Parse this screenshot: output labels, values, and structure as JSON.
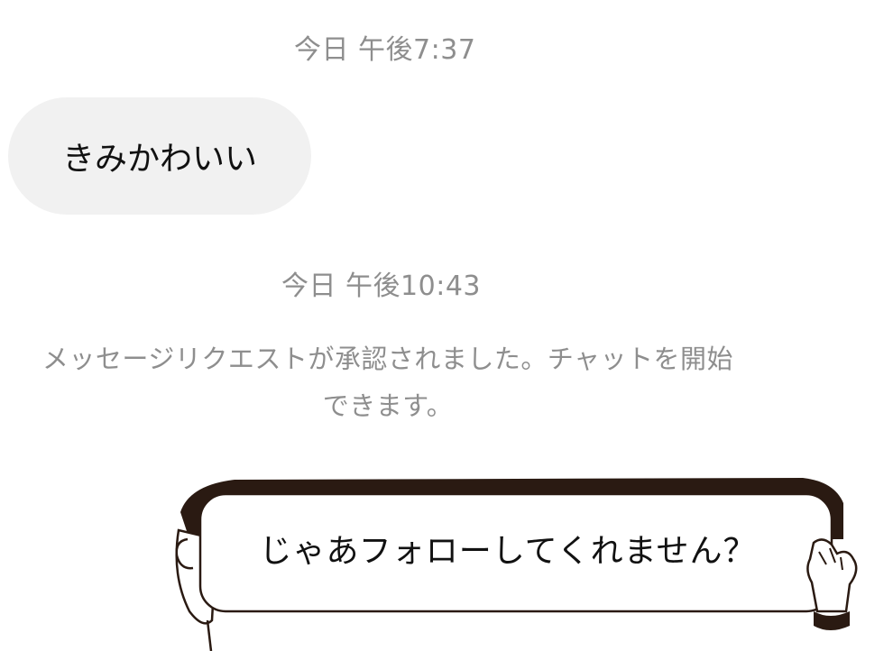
{
  "chat": {
    "timestamp_1": "今日 午後7:37",
    "received_message": "きみかわいい",
    "timestamp_2": "今日 午後10:43",
    "system_message_line1": "メッセージリクエストが承認されました。チャットを開始",
    "system_message_line2": "できます。"
  },
  "sign": {
    "text": "じゃあフォローしてくれません？"
  },
  "colors": {
    "background": "#ffffff",
    "bubble": "#f1f1f1",
    "timestamp": "#8e8e8e",
    "text": "#111111",
    "hair": "#2a1a12"
  }
}
